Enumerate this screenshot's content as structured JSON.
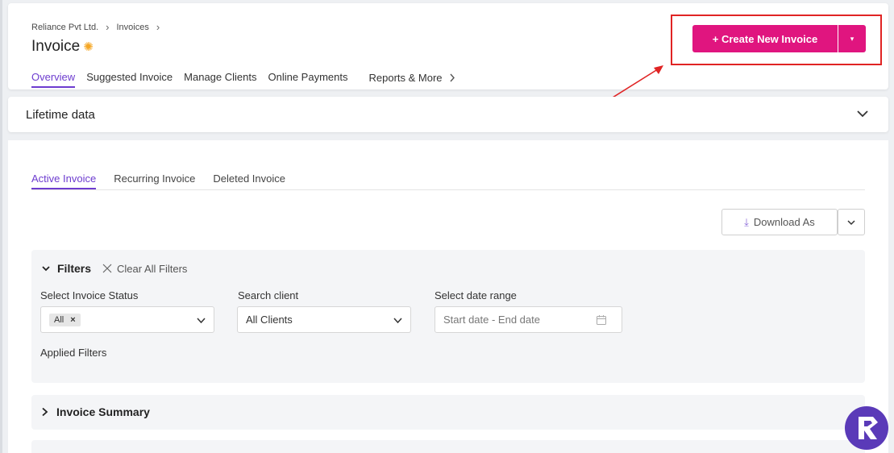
{
  "breadcrumb": {
    "company": "Reliance Pvt Ltd.",
    "section": "Invoices"
  },
  "page": {
    "title": "Invoice"
  },
  "top_tabs": [
    {
      "label": "Overview",
      "active": true
    },
    {
      "label": "Suggested Invoice",
      "active": false
    },
    {
      "label": "Manage Clients",
      "active": false
    },
    {
      "label": "Online Payments",
      "active": false
    },
    {
      "label": "Reports & More",
      "active": false
    }
  ],
  "create_button": {
    "label": "+  Create New Invoice",
    "color": "#e0157f"
  },
  "highlight_color": "#e02424",
  "lifetime": {
    "title": "Lifetime data"
  },
  "sub_tabs": [
    {
      "label": "Active Invoice",
      "active": true
    },
    {
      "label": "Recurring Invoice",
      "active": false
    },
    {
      "label": "Deleted Invoice",
      "active": false
    }
  ],
  "download": {
    "label": "Download As"
  },
  "filters": {
    "title": "Filters",
    "clear_label": "Clear All Filters",
    "status": {
      "label": "Select Invoice Status",
      "chip": "All"
    },
    "client": {
      "label": "Search client",
      "value": "All Clients"
    },
    "date": {
      "label": "Select date range",
      "placeholder": "Start date - End date"
    },
    "applied_label": "Applied Filters"
  },
  "summary": {
    "title": "Invoice Summary"
  },
  "accent_color": "#6d3ccf"
}
